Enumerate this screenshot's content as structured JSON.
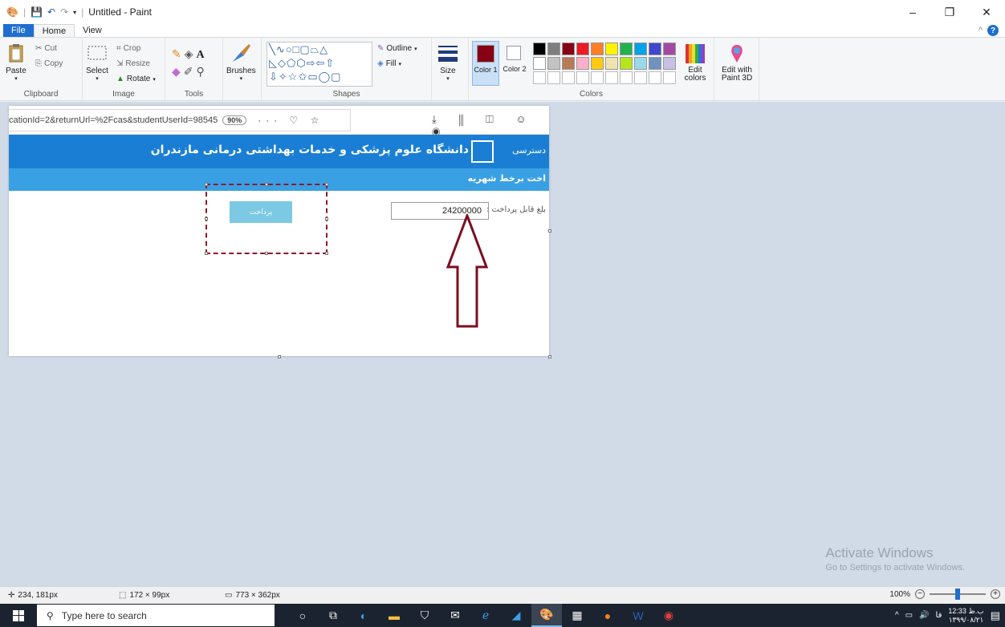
{
  "window": {
    "title": "Untitled - Paint",
    "qat_sep": "|",
    "minimize": "–",
    "restore": "❐",
    "close": "✕"
  },
  "tabs": [
    {
      "label": "File"
    },
    {
      "label": "Home"
    },
    {
      "label": "View"
    }
  ],
  "help": {
    "collapse": "^",
    "icon": "?"
  },
  "ribbon": {
    "clipboard": {
      "label": "Clipboard",
      "paste": "Paste",
      "cut": "Cut",
      "copy": "Copy"
    },
    "image": {
      "label": "Image",
      "select": "Select",
      "crop": "Crop",
      "resize": "Resize",
      "rotate": "Rotate"
    },
    "tools": {
      "label": "Tools"
    },
    "brushes": {
      "label": "Brushes"
    },
    "shapes": {
      "label": "Shapes",
      "outline": "Outline",
      "fill": "Fill"
    },
    "size": {
      "label": "Size"
    },
    "colors": {
      "label": "Colors",
      "color1": "Color 1",
      "color2": "Color 2",
      "color1_value": "#880015",
      "edit": "Edit colors",
      "palette_row1": [
        "#000000",
        "#7f7f7f",
        "#880015",
        "#ed1c24",
        "#ff7f27",
        "#fff200",
        "#22b14c",
        "#00a2e8",
        "#3f48cc",
        "#a349a4"
      ],
      "palette_row2": [
        "#ffffff",
        "#c3c3c3",
        "#b97a57",
        "#ffaec9",
        "#ffc90e",
        "#efe4b0",
        "#b5e61d",
        "#99d9ea",
        "#7092be",
        "#c8bfe7"
      ]
    },
    "paint3d": {
      "label": "Edit with Paint 3D"
    }
  },
  "canvas_image": {
    "url_text": "cationId=2&returnUrl=%2Fcas&studentUserId=98545",
    "zoom": "90%",
    "url_icons": "··· ♡ ☆",
    "browser_icons": "⤓ ⫼ ◫ ☺ ◉",
    "site_title": "دانشگاه علوم پزشکی و خدمات بهداشتی درمانی مازندران",
    "site_access": "دسترسی",
    "subheader": "اخت برخط شهریه",
    "amount_label": "بلغ قابل پرداخت :",
    "amount_value": "24200000",
    "pay_button": "پرداخت",
    "arrow_color": "#7a0f22"
  },
  "status": {
    "cursor": "234, 181px",
    "selection": "172 × 99px",
    "image_size": "773 × 362px",
    "zoom": "100%"
  },
  "watermark": {
    "title": "Activate Windows",
    "subtitle": "Go to Settings to activate Windows."
  },
  "taskbar": {
    "search_placeholder": "Type here to search",
    "lang": "فا",
    "time": "12:33 ب.ظ",
    "date": "۱۳۹۹/۰۸/۲۱"
  }
}
